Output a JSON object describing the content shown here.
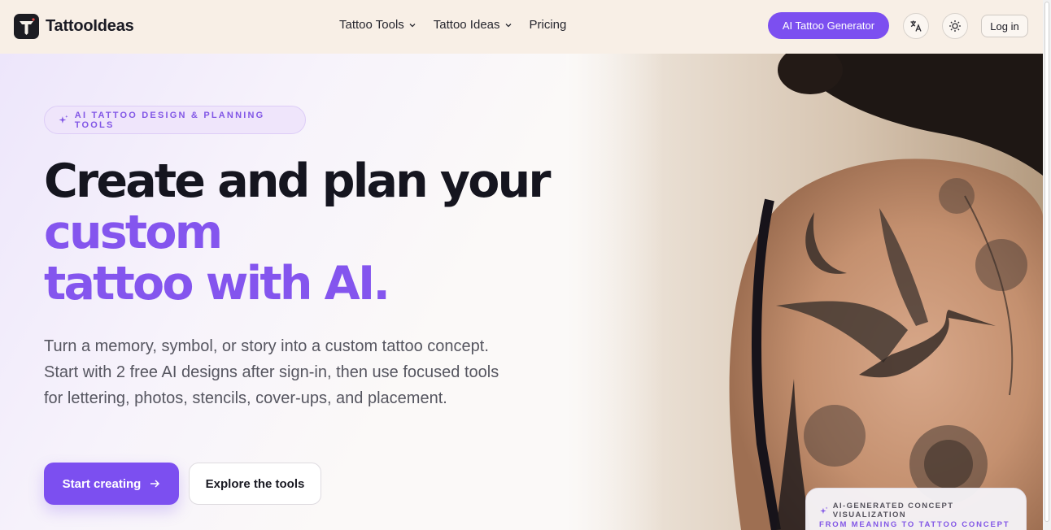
{
  "header": {
    "brand": "TattooIdeas",
    "nav": [
      {
        "label": "Tattoo Tools",
        "has_dropdown": true
      },
      {
        "label": "Tattoo Ideas",
        "has_dropdown": true
      },
      {
        "label": "Pricing",
        "has_dropdown": false
      }
    ],
    "cta_label": "AI Tattoo Generator",
    "translate_icon": "translate-icon",
    "theme_icon": "sun-icon",
    "login_label": "Log in"
  },
  "hero": {
    "badge_icon": "sparkle-icon",
    "badge_text": "AI TATTOO DESIGN & PLANNING TOOLS",
    "headline_dark": "Create and plan your",
    "headline_purple_1": "custom",
    "headline_purple_2": "tattoo with AI.",
    "lead": "Turn a memory, symbol, or story into a custom tattoo concept. Start with 2 free AI designs after sign-in, then use focused tools for lettering, photos, stencils, cover-ups, and placement.",
    "primary_cta": "Start creating",
    "primary_cta_icon": "arrow-right-icon",
    "secondary_cta": "Explore the tools",
    "image_alt": "Back tattoo of a crane with moon and peonies",
    "concept_card": {
      "label": "AI-GENERATED CONCEPT VISUALIZATION",
      "sublabel": "FROM MEANING TO TATTOO CONCEPT"
    }
  },
  "colors": {
    "accent": "#7c4ff0",
    "headline_purple": "#8455ee",
    "header_bg": "#f8efe6"
  }
}
